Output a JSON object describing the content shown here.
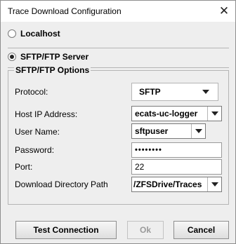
{
  "window": {
    "title": "Trace Download Configuration",
    "close_glyph": "✕"
  },
  "mode_options": {
    "localhost": {
      "label": "Localhost",
      "checked": false
    },
    "sftp": {
      "label": "SFTP/FTP Server",
      "checked": true
    }
  },
  "sftp_options": {
    "legend": "SFTP/FTP Options",
    "protocol": {
      "label": "Protocol:",
      "value": "SFTP"
    },
    "host_ip": {
      "label": "Host IP Address:",
      "value": "ecats-uc-logger"
    },
    "user_name": {
      "label": "User Name:",
      "value": "sftpuser"
    },
    "password": {
      "label": "Password:",
      "masked_value": "••••••••"
    },
    "port": {
      "label": "Port:",
      "value": "22"
    },
    "download_dir": {
      "label": "Download Directory Path",
      "value": "/ZFSDrive/Traces"
    }
  },
  "buttons": {
    "test_connection": "Test Connection",
    "ok": "Ok",
    "cancel": "Cancel"
  }
}
